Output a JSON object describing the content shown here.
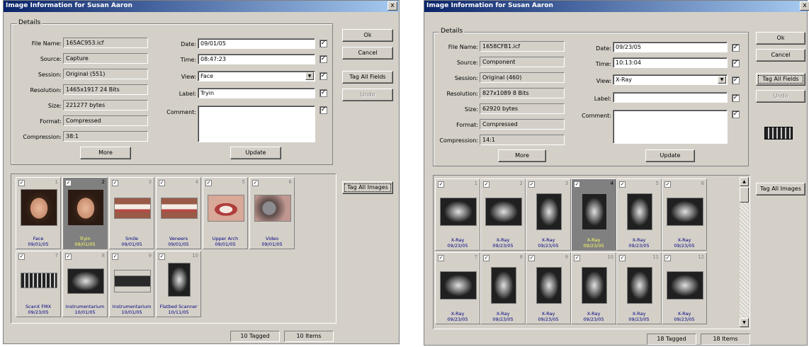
{
  "left": {
    "title": "Image Information for Susan Aaron",
    "close": "x",
    "details_label": "Details",
    "labels": {
      "file_name": "File Name:",
      "source": "Source:",
      "session": "Session:",
      "resolution": "Resolution:",
      "size": "Size:",
      "format": "Format:",
      "compression": "Compression:",
      "date": "Date:",
      "time": "Time:",
      "view": "View:",
      "label": "Label:",
      "comment": "Comment:"
    },
    "values": {
      "file_name": "165AC953.icf",
      "source": "Capture",
      "session": "Original (551)",
      "resolution": "1465x1917 24 Bits",
      "size": "221277 bytes",
      "format": "Compressed",
      "compression": "38:1",
      "date": "09/01/05",
      "time": "08:47:23",
      "view": "Face",
      "label": "Tryin",
      "comment": ""
    },
    "buttons": {
      "ok": "Ok",
      "cancel": "Cancel",
      "tag_all_fields": "Tag All Fields",
      "undo": "Undo",
      "more": "More",
      "update": "Update",
      "tag_all_images": "Tag All Images"
    },
    "thumbs": [
      {
        "num": "1",
        "name": "Face",
        "date": "09/01/05"
      },
      {
        "num": "2",
        "name": "Tryin",
        "date": "09/01/05"
      },
      {
        "num": "3",
        "name": "Smile",
        "date": "09/01/05"
      },
      {
        "num": "4",
        "name": "Veneers",
        "date": "09/01/05"
      },
      {
        "num": "5",
        "name": "Upper Arch",
        "date": "09/01/05"
      },
      {
        "num": "6",
        "name": "Video",
        "date": "09/01/05"
      },
      {
        "num": "7",
        "name": "ScanX FMX",
        "date": "09/23/05"
      },
      {
        "num": "8",
        "name": "Instrumentarium",
        "date": "10/01/05"
      },
      {
        "num": "9",
        "name": "Instrumentarium",
        "date": "10/01/05"
      },
      {
        "num": "10",
        "name": "Flatbed Scanner",
        "date": "10/11/05"
      }
    ],
    "status_tagged": "10 Tagged",
    "status_items": "10 Items"
  },
  "right": {
    "title": "Image Information for Susan Aaron",
    "close": "x",
    "details_label": "Details",
    "labels": {
      "file_name": "File Name:",
      "source": "Source:",
      "session": "Session:",
      "resolution": "Resolution:",
      "size": "Size:",
      "format": "Format:",
      "compression": "Compression:",
      "date": "Date:",
      "time": "Time:",
      "view": "View:",
      "label": "Label:",
      "comment": "Comment:"
    },
    "values": {
      "file_name": "1658CFB1.icf",
      "source": "Component",
      "session": "Original (460)",
      "resolution": "827x1089 8 Bits",
      "size": "62920 bytes",
      "format": "Compressed",
      "compression": "14:1",
      "date": "09/23/05",
      "time": "10:13:04",
      "view": "X-Ray",
      "label": "",
      "comment": ""
    },
    "buttons": {
      "ok": "Ok",
      "cancel": "Cancel",
      "tag_all_fields": "Tag All Fields",
      "undo": "Undo",
      "more": "More",
      "update": "Update",
      "tag_all_images": "Tag All Images"
    },
    "thumbs": [
      {
        "num": "1",
        "name": "X-Ray",
        "date": "09/23/05"
      },
      {
        "num": "2",
        "name": "X-Ray",
        "date": "09/23/05"
      },
      {
        "num": "3",
        "name": "X-Ray",
        "date": "09/23/05"
      },
      {
        "num": "4",
        "name": "X-Ray",
        "date": "09/23/05"
      },
      {
        "num": "5",
        "name": "X-Ray",
        "date": "09/23/05"
      },
      {
        "num": "6",
        "name": "X-Ray",
        "date": "09/23/05"
      },
      {
        "num": "7",
        "name": "X-Ray",
        "date": "09/23/05"
      },
      {
        "num": "8",
        "name": "X-Ray",
        "date": "09/23/05"
      },
      {
        "num": "9",
        "name": "X-Ray",
        "date": "09/23/05"
      },
      {
        "num": "10",
        "name": "X-Ray",
        "date": "09/23/05"
      },
      {
        "num": "11",
        "name": "X-Ray",
        "date": "09/23/05"
      },
      {
        "num": "12",
        "name": "X-Ray",
        "date": "09/23/05"
      }
    ],
    "status_tagged": "18 Tagged",
    "status_items": "18 Items"
  }
}
